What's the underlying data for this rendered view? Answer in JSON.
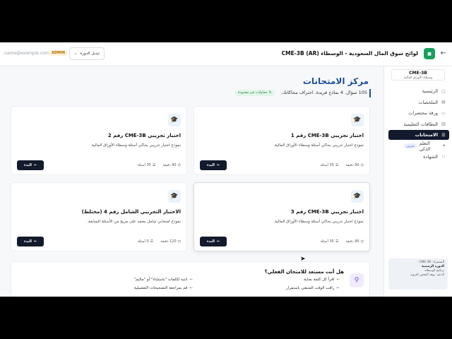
{
  "header": {
    "title": "لوائح سوق المال السعودية - الوسطاء (AR) CME-3B",
    "logo_text": "■",
    "back_icon": "←",
    "email": "name@example.com",
    "admin_label": "ADMIN",
    "course_select_label": "تبديل الدورة",
    "chevron": "⌄"
  },
  "sidebar": {
    "course_code": "CME-3B",
    "course_sub": "وسطاء الأوراق المالية",
    "items": [
      {
        "label": "الرئيسية",
        "icon": "▢"
      },
      {
        "label": "الملخصات",
        "icon": "▤"
      },
      {
        "label": "ورقة مختصرات",
        "icon": "▭"
      },
      {
        "label": "البطاقات التعليمية",
        "icon": "▥"
      },
      {
        "label": "الامتحانات",
        "icon": "☰"
      },
      {
        "label": "التعلم الذكي",
        "icon": "✦",
        "badge": "تجريبي"
      },
      {
        "label": "الشهادة",
        "icon": "⚐"
      }
    ],
    "user": {
      "line1": "المشترك: CME-3B -",
      "line2": "الدورة الرسمية",
      "line3": "برنامج الوسطاء",
      "line4": "الدعم: يوهد الفحص التزويد"
    }
  },
  "main": {
    "title": "مركز الامتحانات",
    "subtitle": "105 سؤال. 4 نماذج فريدة. احتراف محاكاتك.",
    "unlimited_badge": "محاولات غير محدودة",
    "unlimited_icon": "↻",
    "exam_icon": "🎓",
    "clock_icon": "◷",
    "list_icon": "☰",
    "arrow_icon": "←",
    "start_label": "البدء",
    "cards": [
      {
        "title": "اختبار تجريبي CME-3B رقم 1",
        "desc": "نموذج اختبار تدريبي يحاكي أسئلة وسطاء الأوراق المالية.",
        "minutes": "90 دقيقة",
        "questions": "35 أسئلة"
      },
      {
        "title": "اختبار تجريبي CME-3B رقم 2",
        "desc": "نموذج اختبار تدريبي يحاكي أسئلة وسطاء الأوراق المالية.",
        "minutes": "90 دقيقة",
        "questions": "35 أسئلة"
      },
      {
        "title": "اختبار تجريبي CME-3B رقم 3",
        "desc": "نموذج اختبار تدريبي يحاكي أسئلة وسطاء الأوراق المالية.",
        "minutes": "90 دقيقة",
        "questions": "35 أسئلة"
      },
      {
        "title": "الاختبار التجريبي الشامل رقم 4 (مختلط)",
        "desc": "نموذج امتحاني شامل يعتمد على مزيج من الأسئلة السابقة.",
        "minutes": "120 دقيقة",
        "questions": "0 أسئلة"
      }
    ],
    "ready": {
      "title": "هل أنت مستعد للامتحان الفعلي؟",
      "icon": "⚲",
      "tips": [
        "اقرأ كل كلمة بعناية",
        "راقب الوقت المتبقي باستمرار",
        "انتبه لكلمات \"باستثناء\" أو \"ماليم\"",
        "قم بمراجعة التصحيحات التفصيلية"
      ]
    }
  }
}
